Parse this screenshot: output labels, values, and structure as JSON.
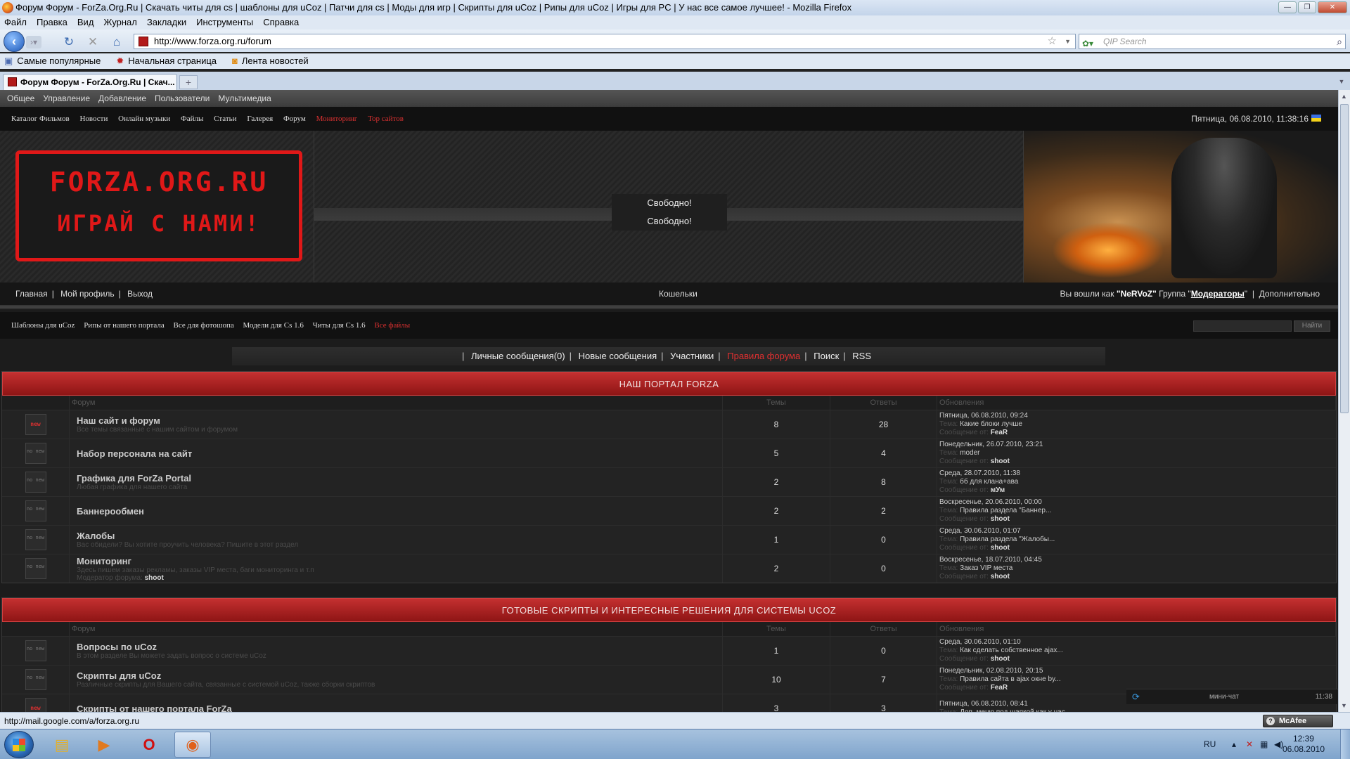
{
  "browser": {
    "window_title": "Форум Форум - ForZa.Org.Ru | Скачать читы для cs | шаблоны для uCoz | Патчи для cs | Моды для игр | Скрипты для uCoz | Рипы для uCoz | Игры для PC | У нас все самое лучшее! - Mozilla Firefox",
    "menu": [
      "Файл",
      "Правка",
      "Вид",
      "Журнал",
      "Закладки",
      "Инструменты",
      "Справка"
    ],
    "url": "http://www.forza.org.ru/forum",
    "search_placeholder": "QIP Search",
    "bookmarks": [
      "Самые популярные",
      "Начальная страница",
      "Лента новостей"
    ],
    "tab_title": "Форум Форум - ForZa.Org.Ru | Скач...",
    "status_text": "http://mail.google.com/a/forza.org.ru",
    "mcafee_label": "McAfee"
  },
  "ucoz_panel": [
    "Общее",
    "Управление",
    "Добавление",
    "Пользователи",
    "Мультимедиа"
  ],
  "site_nav": {
    "items": [
      "Каталог Фильмов",
      "Новости",
      "Онлайн музыки",
      "Файлы",
      "Статьи",
      "Галерея",
      "Форум"
    ],
    "red_items": [
      "Мониторинг",
      "Top сайтов"
    ],
    "date": "Пятница, 06.08.2010, 11:38:16"
  },
  "header": {
    "logo_line1": "FORZA.ORG.RU",
    "logo_line2": "ИГРАЙ С НАМИ!",
    "slots": [
      "Свободно!",
      "Свободно!"
    ]
  },
  "user_nav": {
    "links": [
      "Главная",
      "Мой профиль",
      "Выход"
    ],
    "center": "Кошельки",
    "logged_prefix": "Вы вошли как",
    "username": "\"NeRVoZ\"",
    "group_prefix": "Группа",
    "group": "Модераторы",
    "more": "Дополнительно"
  },
  "links_bar": {
    "items": [
      "Шаблоны для uCoz",
      "Рипы от нашего портала",
      "Все для фотошопа",
      "Модели для Cs 1.6",
      "Читы для Cs 1.6"
    ],
    "red_item": "Все файлы",
    "search_button": "Найти"
  },
  "forum_menu": {
    "items": [
      "Личные сообщения(0)",
      "Новые сообщения",
      "Участники"
    ],
    "red_item": "Правила форума",
    "items_after": [
      "Поиск",
      "RSS"
    ]
  },
  "columns": {
    "forum": "Форум",
    "topics": "Темы",
    "replies": "Ответы",
    "updates": "Обновления"
  },
  "labels": {
    "topic": "Тема:",
    "message_from": "Сообщение от:",
    "moderator": "Модератор форума:"
  },
  "categories": [
    {
      "title": "НАШ ПОРТАЛ FORZA",
      "forums": [
        {
          "icon": "new",
          "icon_text": "new",
          "name": "Наш сайт и форум",
          "desc": "Все темы связанные с нашим сайтом и форумом",
          "topics": "8",
          "replies": "28",
          "date": "Пятница, 06.08.2010, 09:24",
          "last_topic": "Какие блоки лучше",
          "last_author": "FeaR"
        },
        {
          "icon": "no",
          "icon_text": "no new",
          "name": "Набор персонала на сайт",
          "desc": "",
          "topics": "5",
          "replies": "4",
          "date": "Понедельник, 26.07.2010, 23:21",
          "last_topic": "moder",
          "last_author": "shoot"
        },
        {
          "icon": "no",
          "icon_text": "no new",
          "name": "Графика для ForZa Portal",
          "desc": "Любая графика для нашего сайта",
          "topics": "2",
          "replies": "8",
          "date": "Среда, 28.07.2010, 11:38",
          "last_topic": "бб для клана+ава",
          "last_author": "мУм"
        },
        {
          "icon": "no",
          "icon_text": "no new",
          "name": "Баннерообмен",
          "desc": "",
          "topics": "2",
          "replies": "2",
          "date": "Воскресенье, 20.06.2010, 00:00",
          "last_topic": "Правила раздела \"Баннер...",
          "last_author": "shoot"
        },
        {
          "icon": "no",
          "icon_text": "no new",
          "name": "Жалобы",
          "desc": "Вас обидели? Вы хотите проучить человека? Пишите в этот раздел",
          "topics": "1",
          "replies": "0",
          "date": "Среда, 30.06.2010, 01:07",
          "last_topic": "Правила раздела \"Жалобы...",
          "last_author": "shoot"
        },
        {
          "icon": "no",
          "icon_text": "no new",
          "name": "Мониторинг",
          "desc": "Здесь пишем заказы рекламы, заказы VIP места, баги мониторинга и т.п",
          "moderator": "shoot",
          "topics": "2",
          "replies": "0",
          "date": "Воскресенье, 18.07.2010, 04:45",
          "last_topic": "Заказ VIP места",
          "last_author": "shoot"
        }
      ]
    },
    {
      "title": "ГОТОВЫЕ СКРИПТЫ И ИНТЕРЕСНЫЕ РЕШЕНИЯ ДЛЯ СИСТЕМЫ UCOZ",
      "forums": [
        {
          "icon": "no",
          "icon_text": "no new",
          "name": "Вопросы по uCoz",
          "desc": "В этом разделе Вы можете задать вопрос о системе uCoz",
          "topics": "1",
          "replies": "0",
          "date": "Среда, 30.06.2010, 01:10",
          "last_topic": "Как сделать собственное ajax...",
          "last_author": "shoot"
        },
        {
          "icon": "no",
          "icon_text": "no new",
          "name": "Скрипты для uCoz",
          "desc": "Различные скрипты для Вашего сайта, связанные с системой uCoz, также сборки скриптов",
          "topics": "10",
          "replies": "7",
          "date": "Понедельник, 02.08.2010, 20:15",
          "last_topic": "Правила сайта в ajax окне by...",
          "last_author": "FeaR"
        },
        {
          "icon": "new",
          "icon_text": "new",
          "name": "Скрипты от нашего портала ForZa",
          "desc": "",
          "topics": "3",
          "replies": "3",
          "date": "Пятница, 06.08.2010, 08:41",
          "last_topic": "Доп. меню под шапкой как у нас",
          "last_author": ""
        }
      ]
    }
  ],
  "minichat": {
    "label": "мини-чат",
    "time": "11:38"
  },
  "taskbar": {
    "lang": "RU",
    "time": "12:39",
    "date": "06.08.2010"
  },
  "colors": {
    "accent_red": "#c43030",
    "background": "#1c1c1c",
    "logo_red": "#e01818"
  },
  "icons": [
    "back-icon",
    "forward-icon",
    "reload-icon",
    "stop-icon",
    "home-icon",
    "bookmark-star-icon",
    "search-icon",
    "start-icon",
    "explorer-icon",
    "media-icon",
    "opera-icon",
    "firefox-icon"
  ]
}
